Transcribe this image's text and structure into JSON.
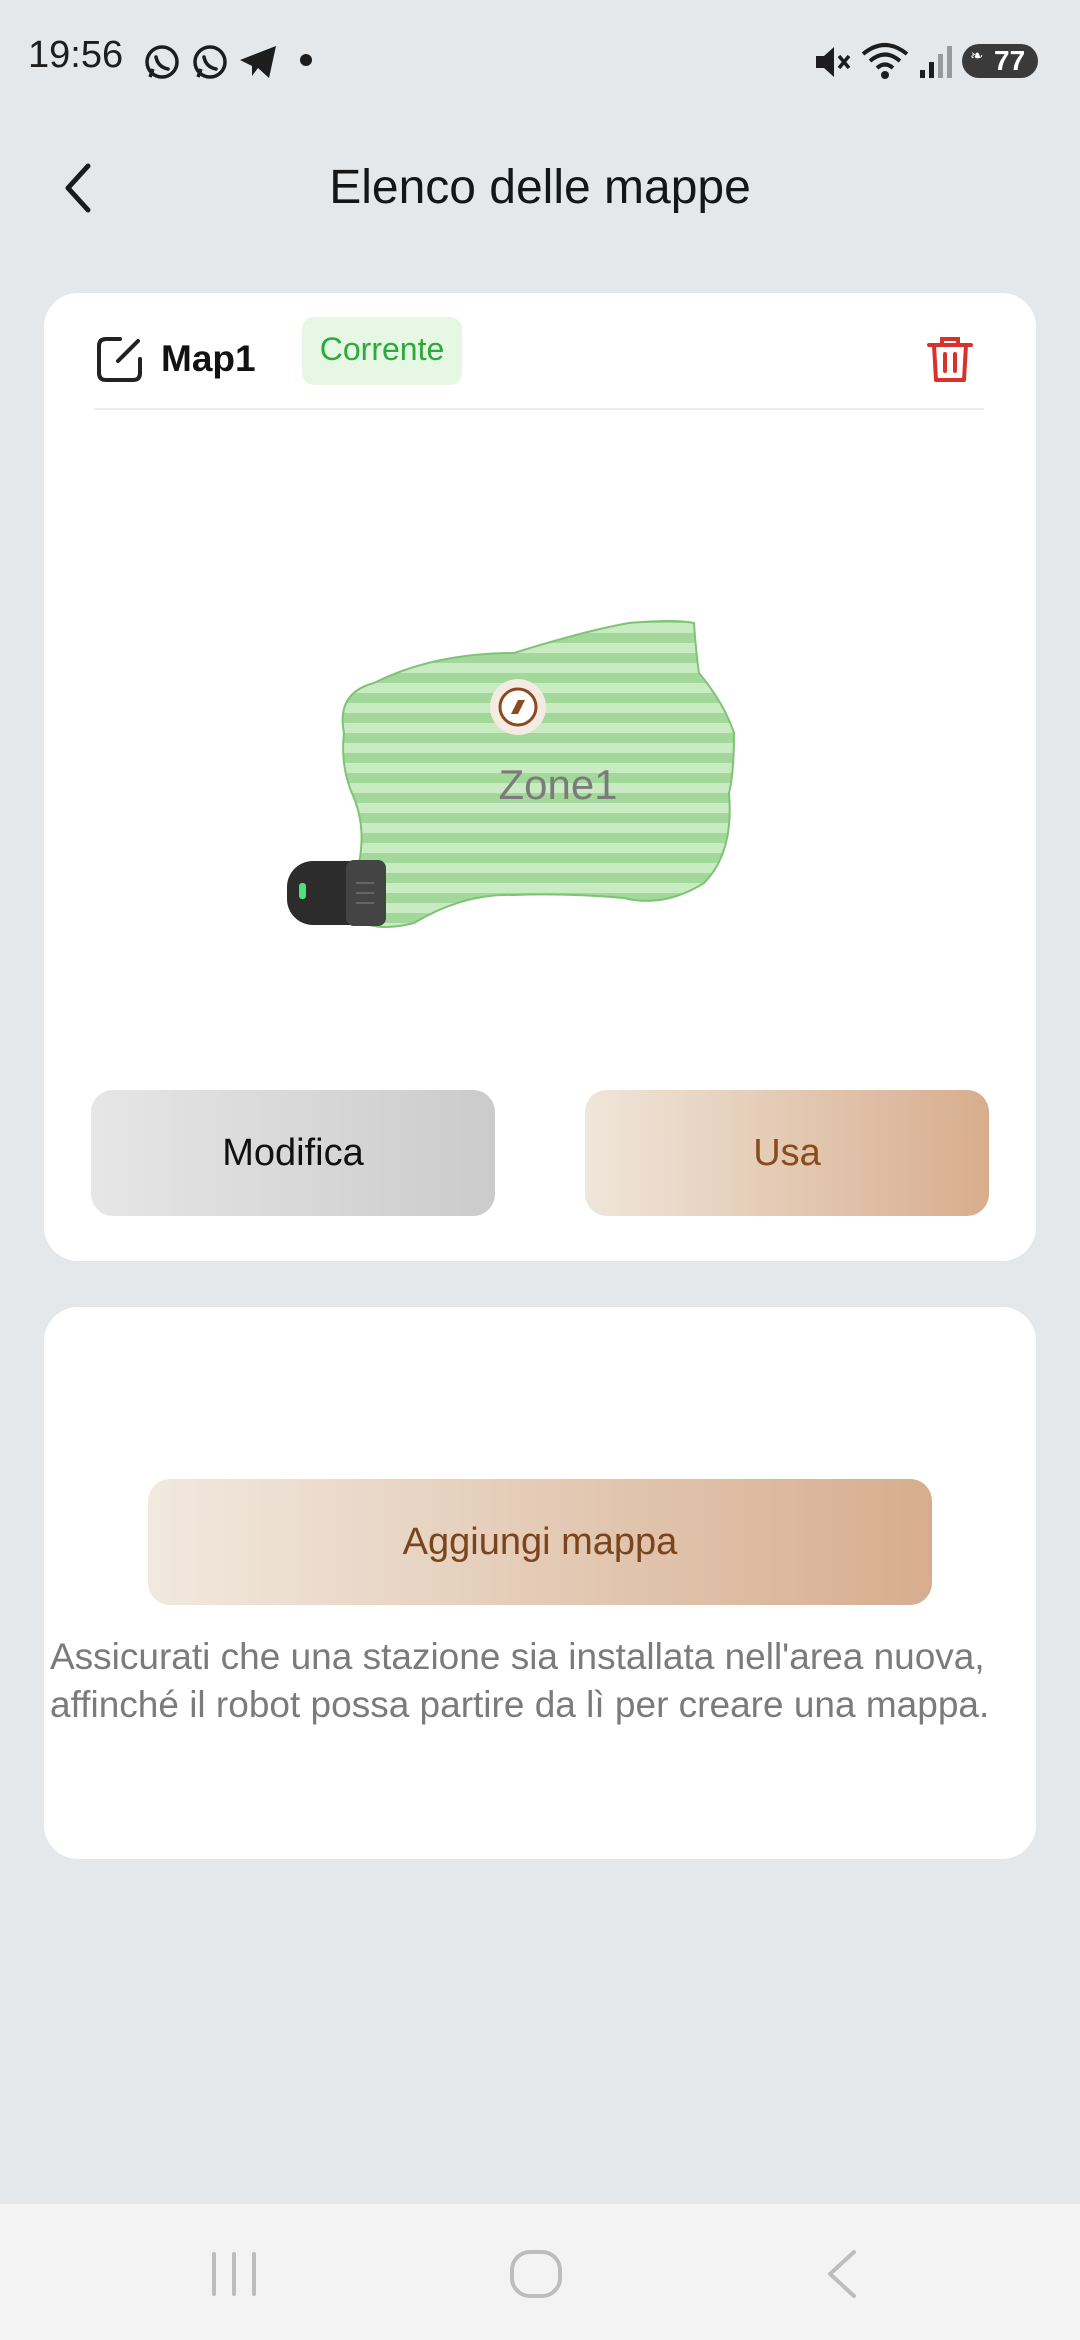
{
  "status_bar": {
    "time": "19:56",
    "notification_icons": [
      "whatsapp-icon",
      "whatsapp-icon",
      "telegram-icon",
      "dot-icon"
    ],
    "system_icons": [
      "mute-icon",
      "wifi-icon",
      "signal-icon",
      "battery-icon"
    ],
    "battery_level": "77"
  },
  "header": {
    "title": "Elenco delle mappe"
  },
  "map_card": {
    "map_name": "Map1",
    "badge": "Corrente",
    "zone_label": "Zone1",
    "edit_button": "Modifica",
    "use_button": "Usa"
  },
  "add_card": {
    "add_button": "Aggiungi mappa",
    "note": "Assicurati che una stazione sia installata nell'area nuova, affinché il robot possa partire da lì per creare una mappa."
  },
  "colors": {
    "background": "#e5e8eb",
    "badge_text": "#2caa3c",
    "badge_bg": "#e6f7e4",
    "delete": "#d9322b",
    "accent_text": "#8a4b1c",
    "zone_fill": "#a8dca0"
  }
}
